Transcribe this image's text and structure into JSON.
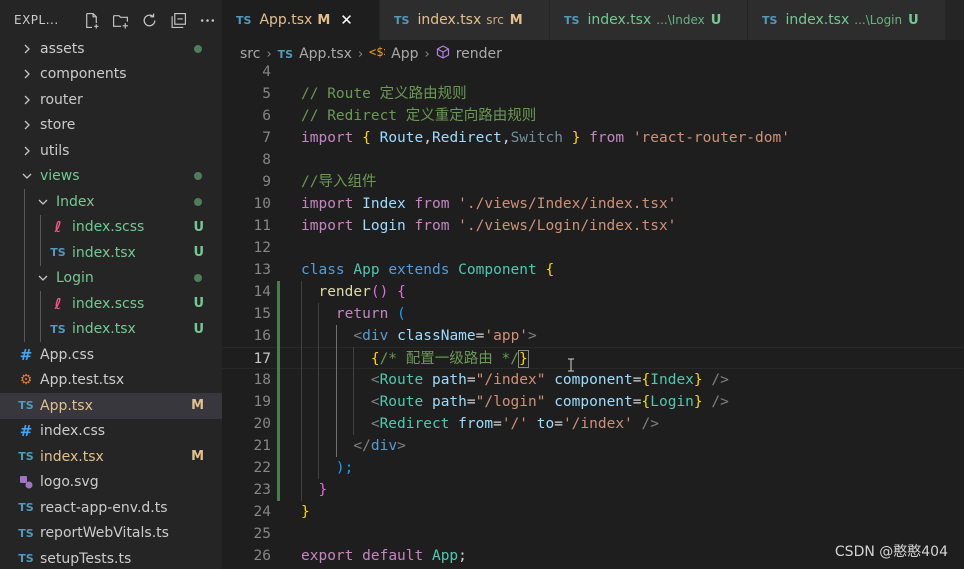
{
  "explorer": {
    "title": "EXPL...",
    "actions": [
      "new-file-icon",
      "new-folder-icon",
      "refresh-icon",
      "collapse-all-icon",
      "more-icon"
    ]
  },
  "tree": [
    {
      "name": "assets",
      "kind": "folder",
      "open": false,
      "indent": 0,
      "status": "dot",
      "color": "#cccccc"
    },
    {
      "name": "components",
      "kind": "folder",
      "open": false,
      "indent": 0,
      "status": "",
      "color": "#cccccc"
    },
    {
      "name": "router",
      "kind": "folder",
      "open": false,
      "indent": 0,
      "status": "",
      "color": "#cccccc"
    },
    {
      "name": "store",
      "kind": "folder",
      "open": false,
      "indent": 0,
      "status": "",
      "color": "#cccccc"
    },
    {
      "name": "utils",
      "kind": "folder",
      "open": false,
      "indent": 0,
      "status": "",
      "color": "#cccccc"
    },
    {
      "name": "views",
      "kind": "folder",
      "open": true,
      "indent": 0,
      "status": "dot",
      "color": "#73c991"
    },
    {
      "name": "Index",
      "kind": "folder",
      "open": true,
      "indent": 1,
      "status": "dot",
      "color": "#73c991"
    },
    {
      "name": "index.scss",
      "kind": "scss",
      "indent": 2,
      "status": "U",
      "color": "#73c991"
    },
    {
      "name": "index.tsx",
      "kind": "ts",
      "indent": 2,
      "status": "U",
      "color": "#73c991"
    },
    {
      "name": "Login",
      "kind": "folder",
      "open": true,
      "indent": 1,
      "status": "dot",
      "color": "#73c991"
    },
    {
      "name": "index.scss",
      "kind": "scss",
      "indent": 2,
      "status": "U",
      "color": "#73c991"
    },
    {
      "name": "index.tsx",
      "kind": "ts",
      "indent": 2,
      "status": "U",
      "color": "#73c991"
    },
    {
      "name": "App.css",
      "kind": "css",
      "indent": 0,
      "status": "",
      "color": "#cccccc"
    },
    {
      "name": "App.test.tsx",
      "kind": "test",
      "indent": 0,
      "status": "",
      "color": "#cccccc"
    },
    {
      "name": "App.tsx",
      "kind": "ts",
      "indent": 0,
      "status": "M",
      "color": "#e2c08d",
      "selected": true
    },
    {
      "name": "index.css",
      "kind": "css",
      "indent": 0,
      "status": "",
      "color": "#cccccc"
    },
    {
      "name": "index.tsx",
      "kind": "ts",
      "indent": 0,
      "status": "M",
      "color": "#e2c08d"
    },
    {
      "name": "logo.svg",
      "kind": "svg",
      "indent": 0,
      "status": "",
      "color": "#cccccc"
    },
    {
      "name": "react-app-env.d.ts",
      "kind": "ts",
      "indent": 0,
      "status": "",
      "color": "#cccccc"
    },
    {
      "name": "reportWebVitals.ts",
      "kind": "ts",
      "indent": 0,
      "status": "",
      "color": "#cccccc"
    },
    {
      "name": "setupTests.ts",
      "kind": "ts",
      "indent": 0,
      "status": "",
      "color": "#cccccc"
    }
  ],
  "tabs": [
    {
      "icon": "TS",
      "name": "App.tsx",
      "desc": "",
      "status": "M",
      "active": true,
      "color": "#e2c08d",
      "closable": true
    },
    {
      "icon": "TS",
      "name": "index.tsx",
      "desc": "src",
      "status": "M",
      "active": false,
      "color": "#e2c08d"
    },
    {
      "icon": "TS",
      "name": "index.tsx",
      "desc": "...\\Index",
      "status": "U",
      "active": false,
      "color": "#73c991"
    },
    {
      "icon": "TS",
      "name": "index.tsx",
      "desc": "...\\Login",
      "status": "U",
      "active": false,
      "color": "#73c991"
    }
  ],
  "breadcrumb": {
    "folder": "src",
    "file_icon": "TS",
    "file": "App.tsx",
    "cls": "App",
    "method": "render"
  },
  "current_line": 17,
  "code": [
    {
      "n": "4",
      "t": []
    },
    {
      "n": "5",
      "t": [
        [
          "// Route 定义路由规则",
          "cm"
        ]
      ]
    },
    {
      "n": "6",
      "t": [
        [
          "// Redirect 定义重定向路由规则",
          "cm"
        ]
      ]
    },
    {
      "n": "7",
      "t": [
        [
          "import",
          "kw2"
        ],
        [
          " ",
          "p"
        ],
        [
          "{",
          "b1"
        ],
        [
          " Route",
          "v"
        ],
        [
          ",",
          "p"
        ],
        [
          "Redirect",
          "v"
        ],
        [
          ",",
          "p"
        ],
        [
          "Switch",
          "dim"
        ],
        [
          " ",
          "p"
        ],
        [
          "}",
          "b1"
        ],
        [
          " ",
          "p"
        ],
        [
          "from",
          "kw2"
        ],
        [
          " ",
          "p"
        ],
        [
          "'react-router-dom'",
          "str"
        ]
      ]
    },
    {
      "n": "8",
      "t": []
    },
    {
      "n": "9",
      "t": [
        [
          "//导入组件",
          "cm"
        ]
      ]
    },
    {
      "n": "10",
      "t": [
        [
          "import",
          "kw2"
        ],
        [
          " Index ",
          "v"
        ],
        [
          "from",
          "kw2"
        ],
        [
          " ",
          "p"
        ],
        [
          "'./views/Index/index.tsx'",
          "str"
        ]
      ]
    },
    {
      "n": "11",
      "t": [
        [
          "import",
          "kw2"
        ],
        [
          " Login ",
          "v"
        ],
        [
          "from",
          "kw2"
        ],
        [
          " ",
          "p"
        ],
        [
          "'./views/Login/index.tsx'",
          "str"
        ]
      ]
    },
    {
      "n": "12",
      "t": []
    },
    {
      "n": "13",
      "t": [
        [
          "class",
          "kw"
        ],
        [
          " ",
          "p"
        ],
        [
          "App",
          "cls"
        ],
        [
          " ",
          "p"
        ],
        [
          "extends",
          "kw"
        ],
        [
          " ",
          "p"
        ],
        [
          "Component",
          "cls"
        ],
        [
          " ",
          "p"
        ],
        [
          "{",
          "b1"
        ]
      ]
    },
    {
      "n": "14",
      "t": [
        [
          "  ",
          "p"
        ],
        [
          "render",
          "fn"
        ],
        [
          "()",
          "b2"
        ],
        [
          " ",
          "p"
        ],
        [
          "{",
          "b2"
        ]
      ]
    },
    {
      "n": "15",
      "t": [
        [
          "    ",
          "p"
        ],
        [
          "return",
          "kw2"
        ],
        [
          " ",
          "p"
        ],
        [
          "(",
          "b3"
        ]
      ]
    },
    {
      "n": "16",
      "t": [
        [
          "      ",
          "p"
        ],
        [
          "<",
          "tg"
        ],
        [
          "div",
          "tag"
        ],
        [
          " ",
          "p"
        ],
        [
          "className",
          "attr"
        ],
        [
          "=",
          "p"
        ],
        [
          "'app'",
          "str"
        ],
        [
          ">",
          "tg"
        ]
      ]
    },
    {
      "n": "17",
      "t": [
        [
          "        ",
          "p"
        ],
        [
          "{",
          "b1"
        ],
        [
          "/* 配置一级路由 */",
          "cm"
        ],
        [
          "}",
          "b1"
        ]
      ]
    },
    {
      "n": "18",
      "t": [
        [
          "        ",
          "p"
        ],
        [
          "<",
          "tg"
        ],
        [
          "Route",
          "cls"
        ],
        [
          " ",
          "p"
        ],
        [
          "path",
          "attr"
        ],
        [
          "=",
          "p"
        ],
        [
          "\"/index\"",
          "str"
        ],
        [
          " ",
          "p"
        ],
        [
          "component",
          "attr"
        ],
        [
          "=",
          "p"
        ],
        [
          "{",
          "b1"
        ],
        [
          "Index",
          "cls"
        ],
        [
          "}",
          "b1"
        ],
        [
          " ",
          "p"
        ],
        [
          "/>",
          "tg"
        ]
      ]
    },
    {
      "n": "19",
      "t": [
        [
          "        ",
          "p"
        ],
        [
          "<",
          "tg"
        ],
        [
          "Route",
          "cls"
        ],
        [
          " ",
          "p"
        ],
        [
          "path",
          "attr"
        ],
        [
          "=",
          "p"
        ],
        [
          "\"/login\"",
          "str"
        ],
        [
          " ",
          "p"
        ],
        [
          "component",
          "attr"
        ],
        [
          "=",
          "p"
        ],
        [
          "{",
          "b1"
        ],
        [
          "Login",
          "cls"
        ],
        [
          "}",
          "b1"
        ],
        [
          " ",
          "p"
        ],
        [
          "/>",
          "tg"
        ]
      ]
    },
    {
      "n": "20",
      "t": [
        [
          "        ",
          "p"
        ],
        [
          "<",
          "tg"
        ],
        [
          "Redirect",
          "cls"
        ],
        [
          " ",
          "p"
        ],
        [
          "from",
          "attr"
        ],
        [
          "=",
          "p"
        ],
        [
          "'/'",
          "str"
        ],
        [
          " ",
          "p"
        ],
        [
          "to",
          "attr"
        ],
        [
          "=",
          "p"
        ],
        [
          "'/index'",
          "str"
        ],
        [
          " ",
          "p"
        ],
        [
          "/>",
          "tg"
        ]
      ]
    },
    {
      "n": "21",
      "t": [
        [
          "      ",
          "p"
        ],
        [
          "</",
          "tg"
        ],
        [
          "div",
          "tag"
        ],
        [
          ">",
          "tg"
        ]
      ]
    },
    {
      "n": "22",
      "t": [
        [
          "    ",
          "p"
        ],
        [
          ");",
          "b3"
        ]
      ]
    },
    {
      "n": "23",
      "t": [
        [
          "  ",
          "p"
        ],
        [
          "}",
          "b2"
        ]
      ]
    },
    {
      "n": "24",
      "t": [
        [
          "}",
          "b1"
        ]
      ]
    },
    {
      "n": "25",
      "t": []
    },
    {
      "n": "26",
      "t": [
        [
          "export",
          "kw2"
        ],
        [
          " ",
          "p"
        ],
        [
          "default",
          "kw2"
        ],
        [
          " ",
          "p"
        ],
        [
          "App",
          "cls"
        ],
        [
          ";",
          "p"
        ]
      ]
    }
  ],
  "colors": {
    "cm": "#6a9955",
    "kw": "#569cd6",
    "kw2": "#c586c0",
    "v": "#9cdcfe",
    "str": "#ce9178",
    "cls": "#4ec9b0",
    "fn": "#dcdcaa",
    "b1": "#ffd700",
    "b2": "#da70d6",
    "b3": "#179fff",
    "tg": "#808080",
    "tag": "#569cd6",
    "attr": "#9cdcfe",
    "p": "#d4d4d4",
    "dim": "#6f8f9e"
  },
  "watermark": "CSDN @憨憨404"
}
